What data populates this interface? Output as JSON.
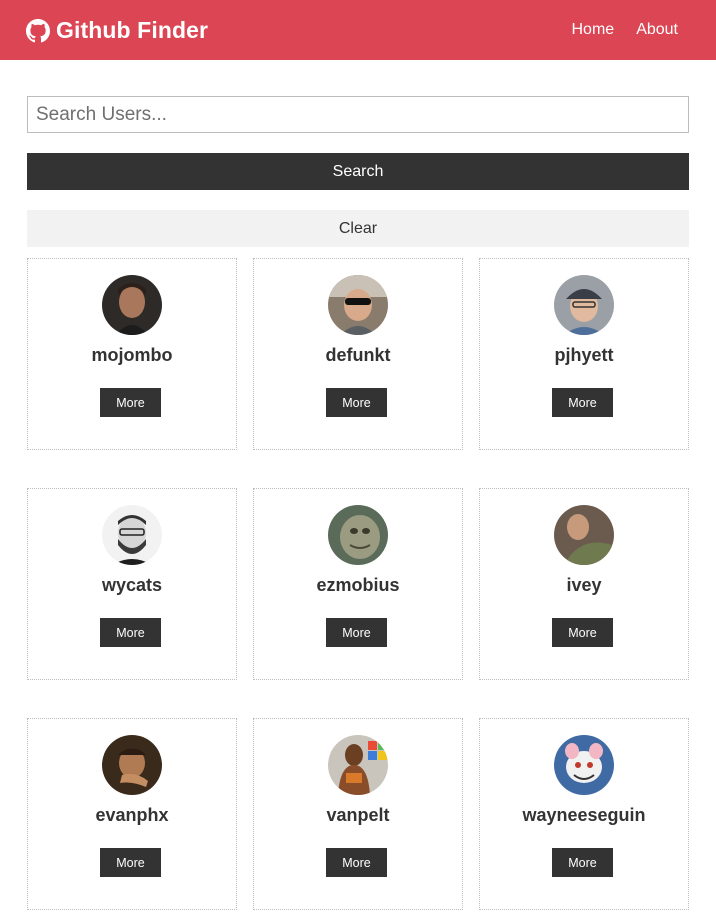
{
  "navbar": {
    "brand_icon": "github-icon",
    "brand_title": "Github Finder",
    "links": [
      "Home",
      "About"
    ],
    "color": "#dc4553"
  },
  "search": {
    "placeholder": "Search Users...",
    "value": "",
    "search_label": "Search",
    "clear_label": "Clear"
  },
  "users": [
    {
      "login": "mojombo",
      "more_label": "More"
    },
    {
      "login": "defunkt",
      "more_label": "More"
    },
    {
      "login": "pjhyett",
      "more_label": "More"
    },
    {
      "login": "wycats",
      "more_label": "More"
    },
    {
      "login": "ezmobius",
      "more_label": "More"
    },
    {
      "login": "ivey",
      "more_label": "More"
    },
    {
      "login": "evanphx",
      "more_label": "More"
    },
    {
      "login": "vanpelt",
      "more_label": "More"
    },
    {
      "login": "wayneeseguin",
      "more_label": "More"
    }
  ]
}
